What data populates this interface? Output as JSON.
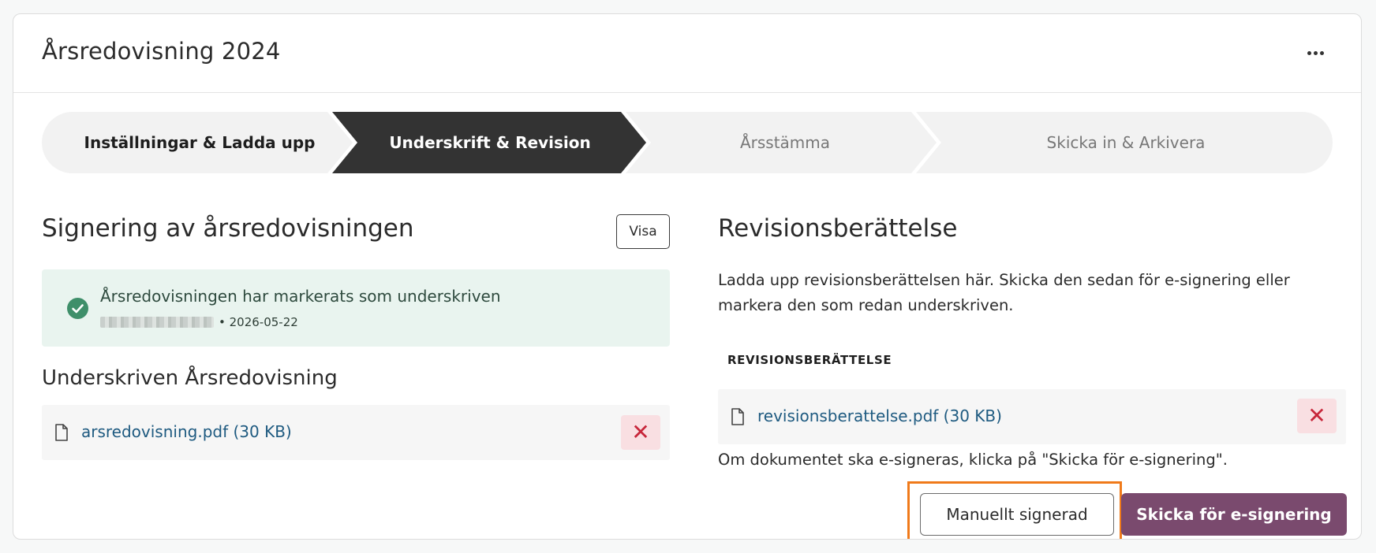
{
  "header": {
    "title": "Årsredovisning 2024",
    "more_icon": "more-horizontal-icon"
  },
  "stepper": {
    "steps": [
      {
        "label": "Inställningar & Ladda upp",
        "state": "done"
      },
      {
        "label": "Underskrift & Revision",
        "state": "active"
      },
      {
        "label": "Årsstämma",
        "state": "upcoming"
      },
      {
        "label": "Skicka in & Arkivera",
        "state": "upcoming"
      }
    ],
    "colors": {
      "active_bg": "#333333",
      "inactive_bg": "#f2f2f2",
      "done_text": "#1e1e1e",
      "upcoming_text": "#777777"
    }
  },
  "signing": {
    "title": "Signering av årsredovisningen",
    "view_button": "Visa",
    "status": {
      "message": "Årsredovisningen har markerats som underskriven",
      "meta": "• 2026-05-22"
    },
    "signed_title": "Underskriven Årsredovisning",
    "file": {
      "name": "arsredovisning.pdf (30 KB)",
      "delete_label": "✕"
    }
  },
  "audit": {
    "title": "Revisionsberättelse",
    "description": "Ladda upp revisionsberättelsen här. Skicka den sedan för e-signering eller markera den som redan underskriven.",
    "file_label": "REVISIONSBERÄTTELSE",
    "file": {
      "name": "revisionsberattelse.pdf (30 KB)",
      "delete_label": "✕"
    },
    "hint": "Om dokumentet ska e-signeras, klicka på \"Skicka för e-signering\".",
    "manual_button": "Manuellt signerad",
    "esign_button": "Skicka för e-signering"
  }
}
